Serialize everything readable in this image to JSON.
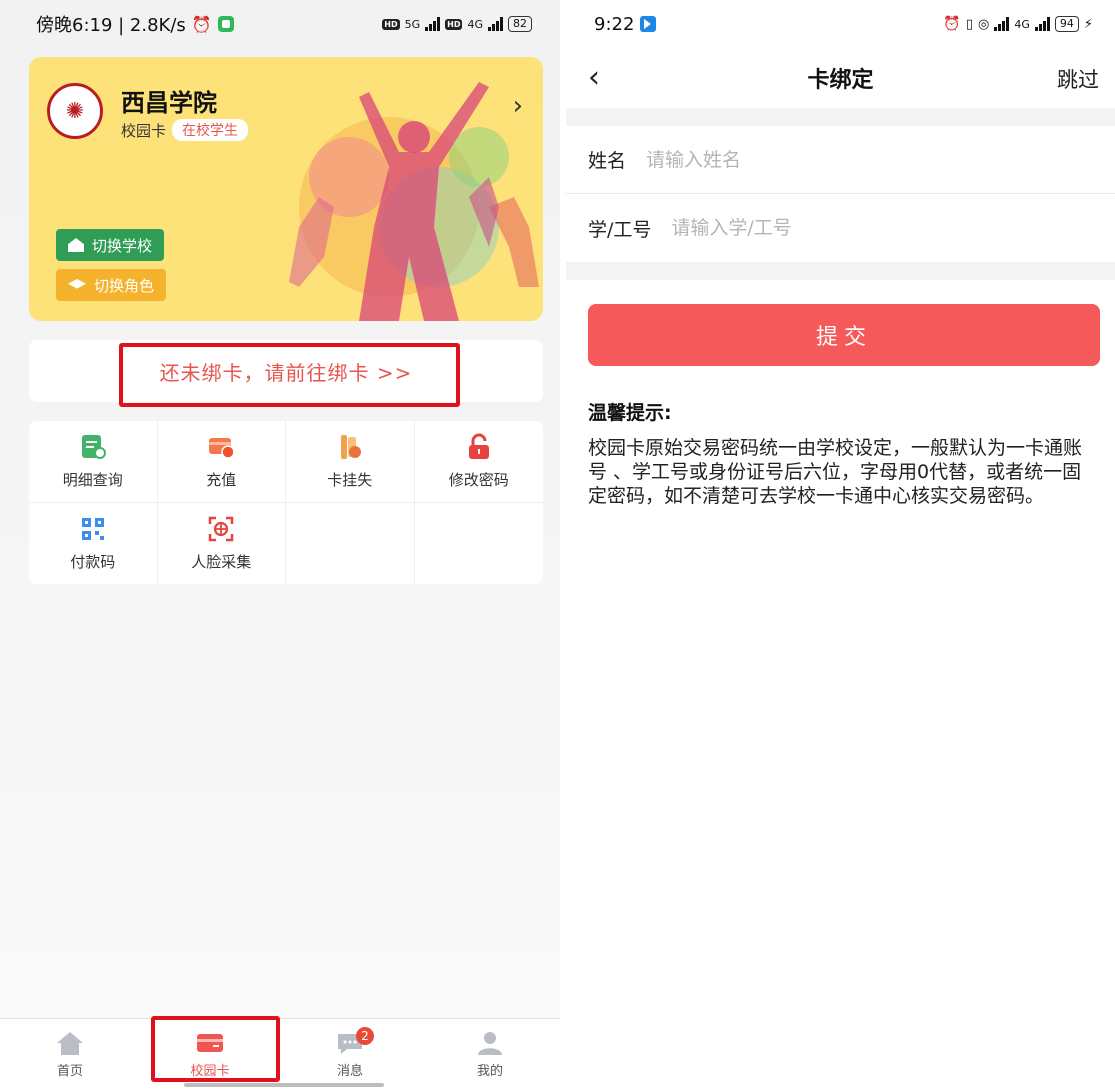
{
  "left_screen": {
    "status": {
      "time": "傍晚6:19 | 2.8K/s",
      "network1": "5G",
      "network2": "4G",
      "battery": "82"
    },
    "banner": {
      "school_name": "西昌学院",
      "card_label": "校园卡",
      "role_badge": "在校学生",
      "switch_school": "切换学校",
      "switch_role": "切换角色"
    },
    "bind_notice": "还未绑卡，请前往绑卡 >>",
    "functions": [
      {
        "label": "明细查询",
        "icon": "detail-query-icon"
      },
      {
        "label": "充值",
        "icon": "recharge-icon"
      },
      {
        "label": "卡挂失",
        "icon": "card-loss-icon"
      },
      {
        "label": "修改密码",
        "icon": "lock-icon"
      },
      {
        "label": "付款码",
        "icon": "qr-code-icon"
      },
      {
        "label": "人脸采集",
        "icon": "face-capture-icon"
      }
    ],
    "tabbar": [
      {
        "label": "首页",
        "icon": "home-icon"
      },
      {
        "label": "校园卡",
        "icon": "card-icon"
      },
      {
        "label": "消息",
        "icon": "message-icon",
        "badge": "2"
      },
      {
        "label": "我的",
        "icon": "person-icon"
      }
    ]
  },
  "right_screen": {
    "status": {
      "time": "9:22",
      "network": "4G",
      "battery": "94"
    },
    "nav": {
      "title": "卡绑定",
      "skip": "跳过"
    },
    "form": {
      "name_label": "姓名",
      "name_placeholder": "请输入姓名",
      "id_label": "学/工号",
      "id_placeholder": "请输入学/工号"
    },
    "submit_label": "提交",
    "tip_title": "温馨提示:",
    "tip_body": "校园卡原始交易密码统一由学校设定，一般默认为一卡通账号 、学工号或身份证号后六位，字母用0代替，或者统一固定密码，如不清楚可去学校一卡通中心核实交易密码。"
  },
  "colors": {
    "accent_red": "#e8554f",
    "submit_red": "#f5595a",
    "banner_yellow": "#fde27a",
    "green": "#2f9d55",
    "orange": "#f5b22d",
    "highlight": "#e0111d"
  }
}
